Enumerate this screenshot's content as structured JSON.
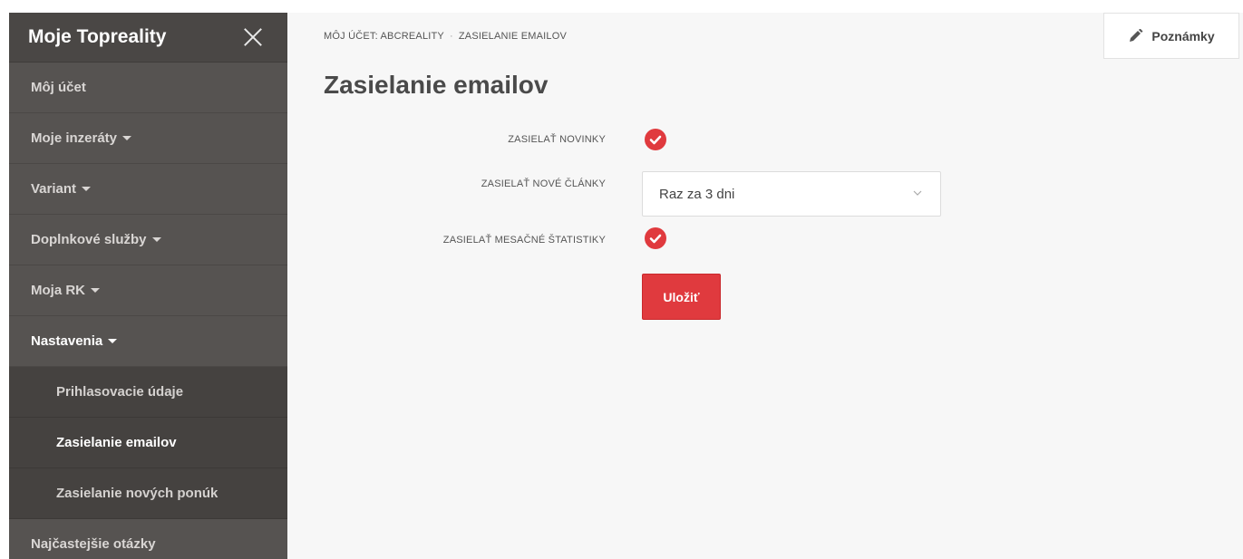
{
  "sidebar": {
    "title": "Moje Topreality",
    "items": [
      {
        "label": "Môj účet",
        "caret": false
      },
      {
        "label": "Moje inzeráty",
        "caret": true
      },
      {
        "label": "Variant",
        "caret": true
      },
      {
        "label": "Doplnkové služby",
        "caret": true
      },
      {
        "label": "Moja RK",
        "caret": true
      },
      {
        "label": "Nastavenia",
        "caret": true
      }
    ],
    "subitems": [
      {
        "label": "Prihlasovacie údaje"
      },
      {
        "label": "Zasielanie emailov"
      },
      {
        "label": "Zasielanie nových ponúk"
      }
    ],
    "last_item": {
      "label": "Najčastejšie otázky"
    }
  },
  "breadcrumb": {
    "first": "MÔJ ÚČET: ABCREALITY",
    "separator": "·",
    "second": "ZASIELANIE EMAILOV"
  },
  "notes_button": {
    "label": "Poznámky",
    "icon": "pencil-icon"
  },
  "page_title": "Zasielanie emailov",
  "form": {
    "novinky_label": "ZASIELAŤ NOVINKY",
    "novinky_checked": true,
    "clanky_label": "ZASIELAŤ NOVÉ ČLÁNKY",
    "clanky_value": "Raz za 3 dni",
    "statistiky_label": "ZASIELAŤ MESAČNÉ ŠTATISTIKY",
    "statistiky_checked": true,
    "save_label": "Uložiť"
  },
  "colors": {
    "accent": "#e03a3e",
    "sidebar_bg": "#565351",
    "sidebar_sub_bg": "#454240"
  }
}
